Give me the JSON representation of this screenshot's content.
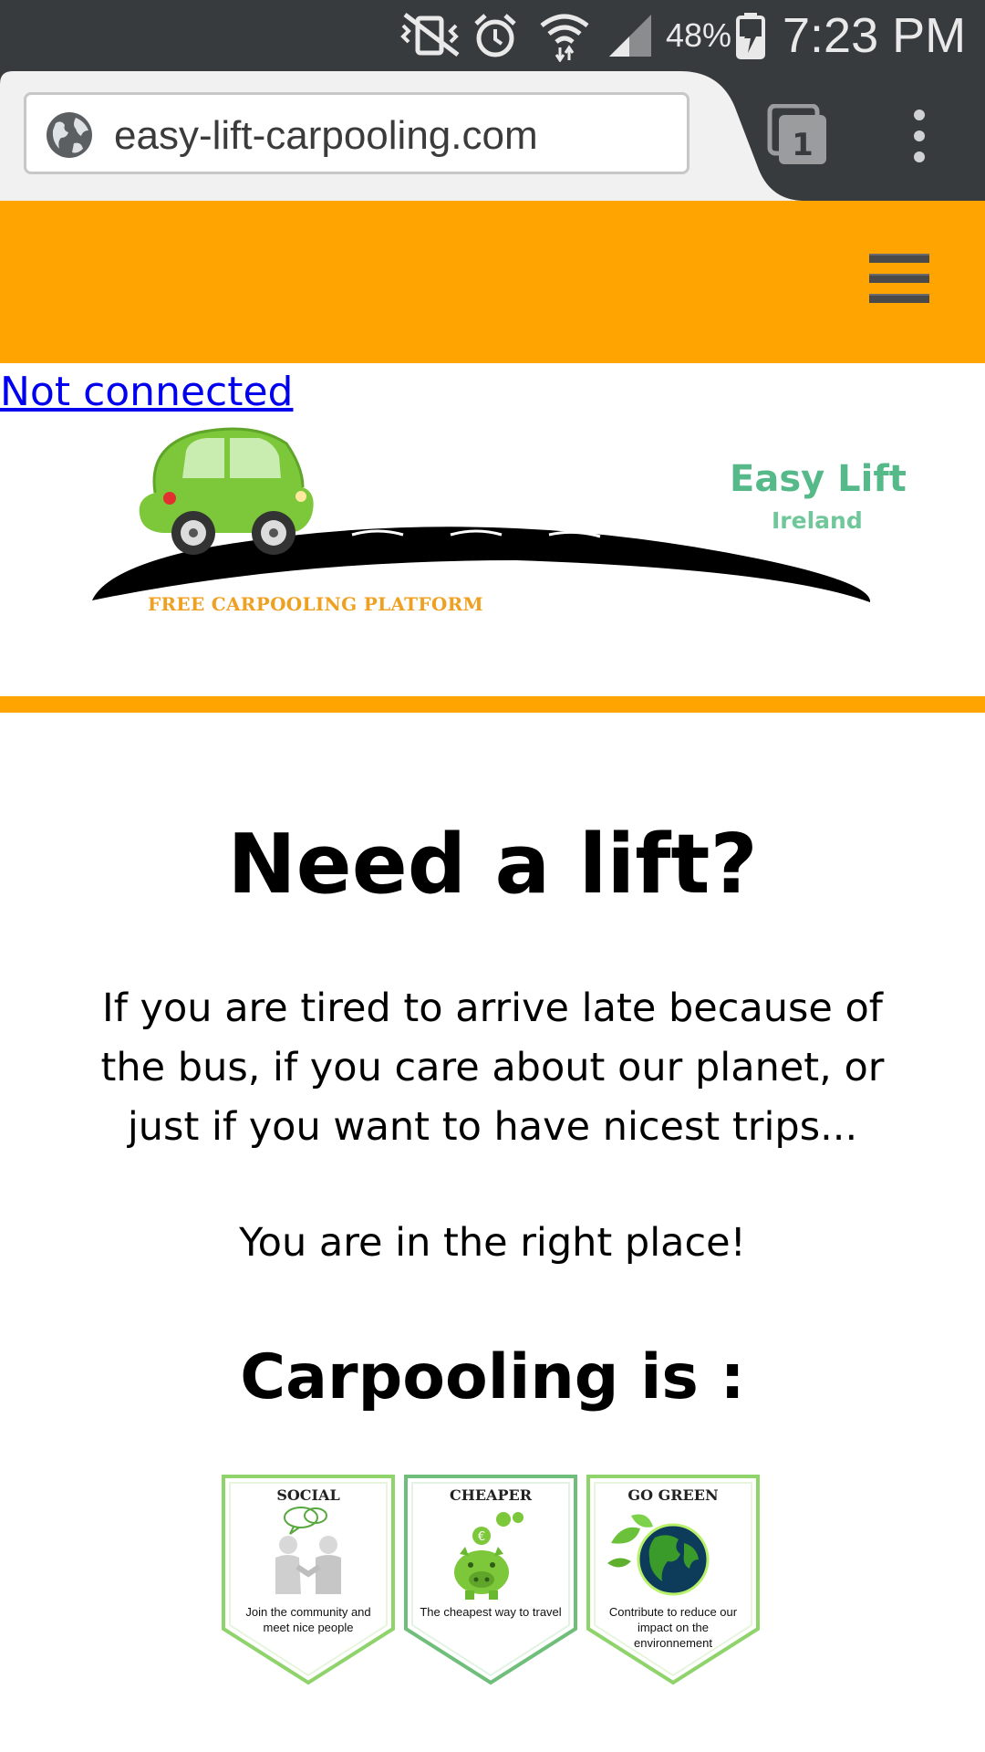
{
  "status_bar": {
    "battery_percent": "48%",
    "time": "7:23 PM",
    "icons": [
      "vibrate-off-icon",
      "alarm-icon",
      "wifi-icon",
      "signal-icon",
      "battery-charging-icon"
    ]
  },
  "browser": {
    "url": "easy-lift-carpooling.com",
    "tab_count": "1",
    "icons": [
      "globe-icon",
      "tabs-icon",
      "overflow-menu-icon"
    ]
  },
  "header": {
    "menu_icon": "hamburger-menu-icon",
    "background_color": "#ffa400"
  },
  "connection_status": {
    "label": "Not connected"
  },
  "logo": {
    "brand": "Easy Lift",
    "country": "Ireland",
    "tagline": "FREE CARPOOLING PLATFORM"
  },
  "hero": {
    "title": "Need a lift?",
    "intro_lines": [
      "If you are tired to arrive late because of",
      "the bus, if you care about our planet, or",
      "just if you want to have nicest trips..."
    ],
    "tagline": "You are in the right place!"
  },
  "benefits": {
    "title": "Carpooling is :",
    "items": [
      {
        "title": "SOCIAL",
        "text": "Join the community and meet nice people",
        "icon": "handshake-people-icon"
      },
      {
        "title": "CHEAPER",
        "text": "The cheapest way to travel",
        "icon": "piggy-bank-icon"
      },
      {
        "title": "GO GREEN",
        "text": "Contribute to reduce our impact on the environnement",
        "icon": "green-globe-icon"
      }
    ]
  }
}
